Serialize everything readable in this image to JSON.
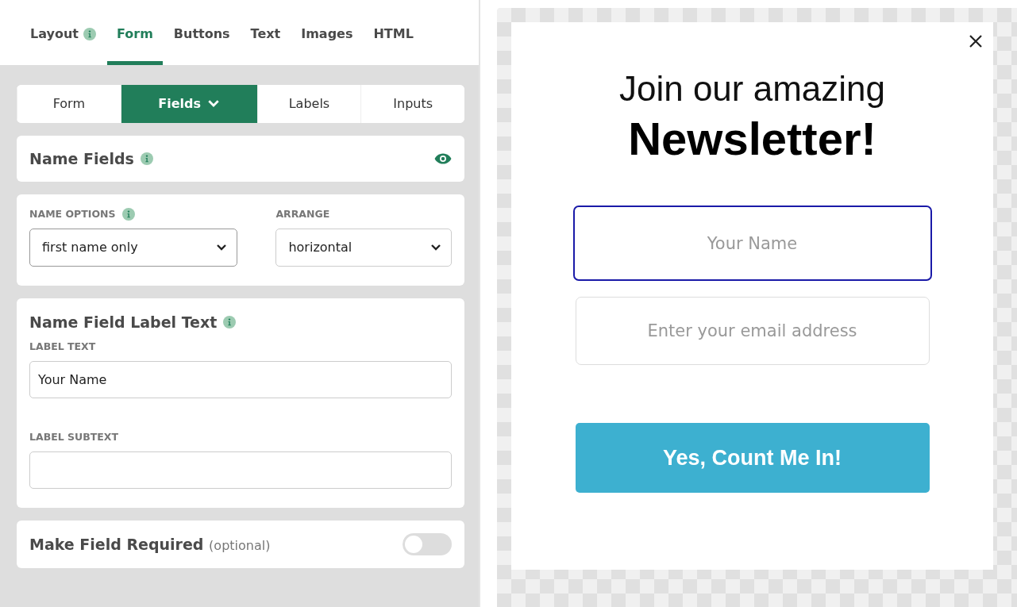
{
  "tabs": [
    {
      "label": "Layout",
      "info": true,
      "selected": false
    },
    {
      "label": "Form",
      "info": false,
      "selected": true
    },
    {
      "label": "Buttons",
      "info": false,
      "selected": false
    },
    {
      "label": "Text",
      "info": false,
      "selected": false
    },
    {
      "label": "Images",
      "info": false,
      "selected": false
    },
    {
      "label": "HTML",
      "info": false,
      "selected": false
    }
  ],
  "subtabs": [
    {
      "label": "Form",
      "caret": false,
      "selected": false
    },
    {
      "label": "Fields",
      "caret": true,
      "selected": true
    },
    {
      "label": "Labels",
      "caret": false,
      "selected": false
    },
    {
      "label": "Inputs",
      "caret": false,
      "selected": false
    }
  ],
  "name_fields": {
    "title": "Name Fields",
    "visible": true
  },
  "options": [
    {
      "label": "NAME OPTIONS",
      "info": true,
      "value": "first name only"
    },
    {
      "label": "ARRANGE",
      "info": false,
      "value": "horizontal"
    }
  ],
  "label_section": {
    "title": "Name Field Label Text",
    "fields": [
      {
        "label": "LABEL TEXT",
        "value": "Your Name"
      },
      {
        "label": "LABEL SUBTEXT"
      }
    ]
  },
  "required": {
    "title": "Make Field Required",
    "note": "(optional)",
    "on": false
  },
  "popup": {
    "heading": "Join our amazing",
    "subheading": "Newsletter!",
    "inputs": [
      {
        "placeholder": "Your Name",
        "focused": true
      },
      {
        "placeholder": "Enter your email address",
        "focused": false
      }
    ],
    "button": "Yes, Count Me In!"
  }
}
